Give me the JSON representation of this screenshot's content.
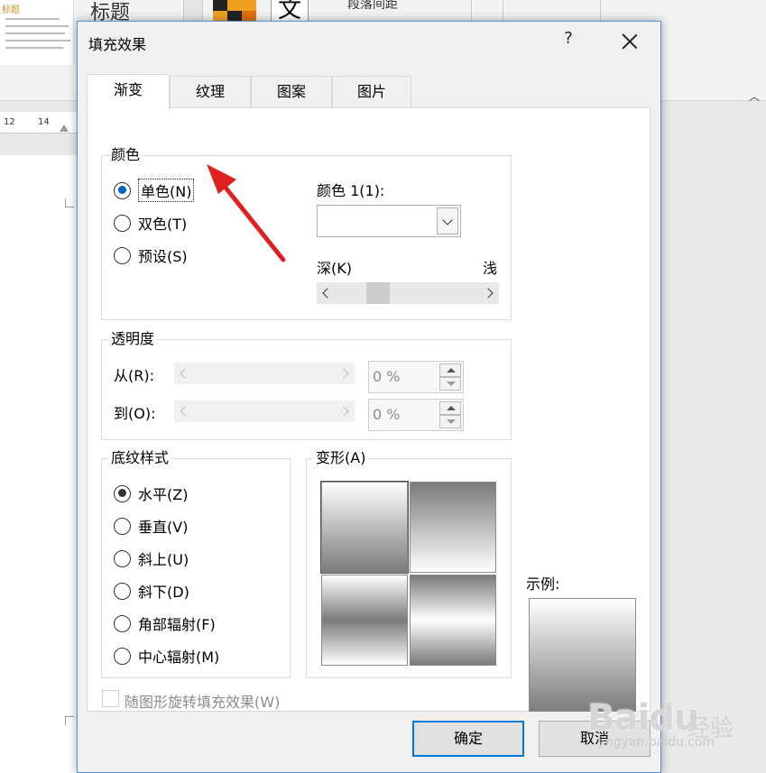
{
  "background": {
    "thumbnail_title": "标题",
    "style_label": "标题",
    "text_button": "文",
    "paragraph_text": "段落间距",
    "ruler_labels": [
      "12",
      "14"
    ]
  },
  "dialog": {
    "title": "填充效果",
    "help": "?",
    "tabs": [
      {
        "label": "渐变",
        "active": true
      },
      {
        "label": "纹理",
        "active": false
      },
      {
        "label": "图案",
        "active": false
      },
      {
        "label": "图片",
        "active": false
      }
    ],
    "colors_group": {
      "label": "颜色",
      "options": [
        {
          "label": "单色(N)",
          "selected": true
        },
        {
          "label": "双色(T)",
          "selected": false
        },
        {
          "label": "预设(S)",
          "selected": false
        }
      ],
      "color1_label": "颜色 1(1):",
      "color1_value": "",
      "dark_label": "深(K)",
      "light_label": "浅"
    },
    "transparency_group": {
      "label": "透明度",
      "from_label": "从(R):",
      "from_value": "0 %",
      "to_label": "到(O):",
      "to_value": "0 %"
    },
    "shading_styles": {
      "label": "底纹样式",
      "options": [
        {
          "label": "水平(Z)",
          "selected": true
        },
        {
          "label": "垂直(V)",
          "selected": false
        },
        {
          "label": "斜上(U)",
          "selected": false
        },
        {
          "label": "斜下(D)",
          "selected": false
        },
        {
          "label": "角部辐射(F)",
          "selected": false
        },
        {
          "label": "中心辐射(M)",
          "selected": false
        }
      ]
    },
    "variants": {
      "label": "变形(A)"
    },
    "sample_label": "示例:",
    "rotate_checkbox": {
      "label": "随图形旋转填充效果(W)",
      "checked": false,
      "enabled": false
    },
    "ok_label": "确定",
    "cancel_label": "取消"
  },
  "annotation": {
    "color": "#e02020"
  },
  "watermark": {
    "logo": "Baidu",
    "label": "经验",
    "url": "jingyan.baidu.com"
  },
  "colors": {
    "accent": "#0078d7",
    "radio_dot": "#0067c0",
    "annotation_red": "#e02020"
  }
}
